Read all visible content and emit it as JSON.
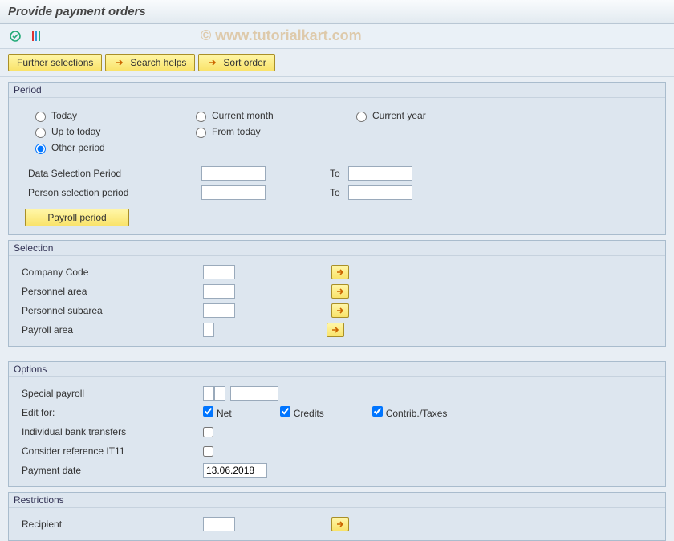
{
  "title": "Provide payment orders",
  "watermark": "© www.tutorialkart.com",
  "toolbar_buttons": {
    "further_selections": "Further selections",
    "search_helps": "Search helps",
    "sort_order": "Sort order"
  },
  "period": {
    "legend": "Period",
    "radios": {
      "today": "Today",
      "current_month": "Current month",
      "current_year": "Current year",
      "up_to_today": "Up to today",
      "from_today": "From today",
      "other_period": "Other period"
    },
    "selected": "other_period",
    "data_selection_label": "Data Selection Period",
    "data_selection_from": "",
    "data_selection_to_label": "To",
    "data_selection_to": "",
    "person_selection_label": "Person selection period",
    "person_selection_from": "",
    "person_selection_to_label": "To",
    "person_selection_to": "",
    "payroll_period_btn": "Payroll period"
  },
  "selection": {
    "legend": "Selection",
    "company_code": {
      "label": "Company Code",
      "value": ""
    },
    "personnel_area": {
      "label": "Personnel area",
      "value": ""
    },
    "personnel_subarea": {
      "label": "Personnel subarea",
      "value": ""
    },
    "payroll_area": {
      "label": "Payroll area",
      "value": ""
    }
  },
  "options": {
    "legend": "Options",
    "special_payroll": {
      "label": "Special payroll",
      "v1": "",
      "v2": "",
      "v3": ""
    },
    "edit_for": {
      "label": "Edit for:",
      "net": {
        "label": "Net",
        "checked": true
      },
      "credits": {
        "label": "Credits",
        "checked": true
      },
      "contrib": {
        "label": "Contrib./Taxes",
        "checked": true
      }
    },
    "individual_transfers": {
      "label": "Individual bank transfers",
      "checked": false
    },
    "consider_ref": {
      "label": "Consider reference IT11",
      "checked": false
    },
    "payment_date": {
      "label": "Payment date",
      "value": "13.06.2018"
    }
  },
  "restrictions": {
    "legend": "Restrictions",
    "recipient": {
      "label": "Recipient",
      "value": ""
    }
  }
}
